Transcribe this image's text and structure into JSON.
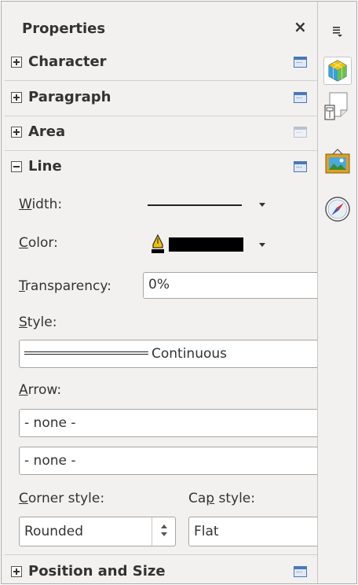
{
  "panel": {
    "title": "Properties",
    "close_glyph": "×"
  },
  "decks": {
    "character": "Character",
    "paragraph": "Paragraph",
    "area": "Area",
    "line": "Line",
    "position_size": "Position and Size"
  },
  "line": {
    "width_label_u": "W",
    "width_label_rest": "idth:",
    "color_label_u": "C",
    "color_label_rest": "olor:",
    "transparency_label_u": "T",
    "transparency_label_rest": "ransparency:",
    "transparency_value": "0%",
    "style_label_u": "S",
    "style_label_rest": "tyle:",
    "style_value": "Continuous",
    "arrow_label_u": "A",
    "arrow_label_rest": "rrow:",
    "arrow_start": "- none -",
    "arrow_end": "- none -",
    "corner_label_u": "C",
    "corner_label_rest": "orner style:",
    "corner_value": "Rounded",
    "cap_label_pre": "Ca",
    "cap_label_u": "p",
    "cap_label_rest": " style:",
    "cap_value": "Flat"
  },
  "colors": {
    "line_color": "#000000",
    "accent": "#4a78b8"
  },
  "tabbar": {
    "menu_icon": "hamburger-menu-icon",
    "tabs": [
      "properties-cube-icon",
      "page-styles-icon",
      "gallery-icon",
      "navigator-compass-icon"
    ]
  }
}
